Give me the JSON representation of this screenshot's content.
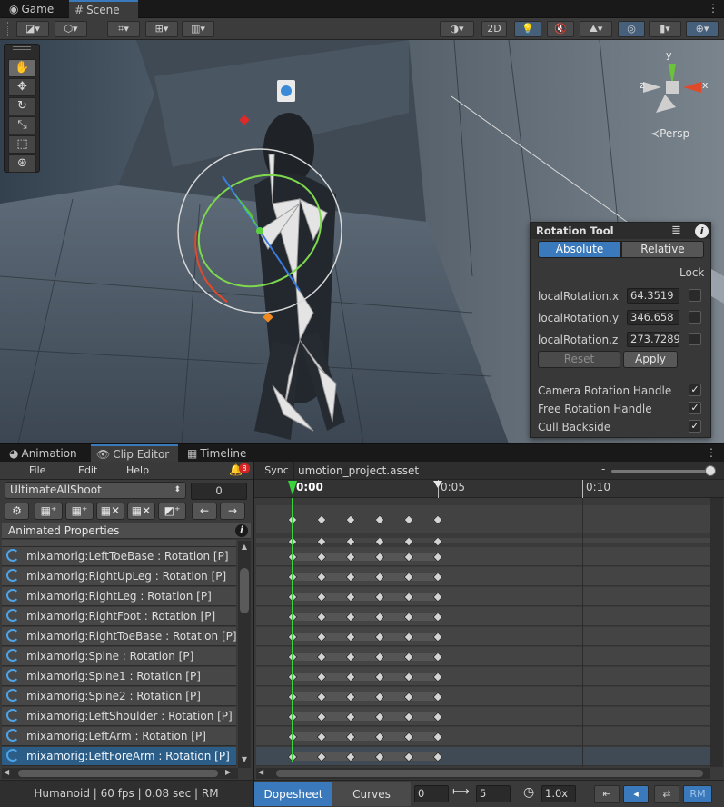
{
  "tabs_top": [
    {
      "label": "Game",
      "icon": "gamepad-icon"
    },
    {
      "label": "Scene",
      "icon": "grid-icon"
    }
  ],
  "toolbar": {
    "two_d_label": "2D"
  },
  "scene": {
    "persp_label": "Persp",
    "gizmo_axes": {
      "x": "x",
      "y": "y",
      "z": "z"
    }
  },
  "tools": [
    "hand-tool",
    "move-tool",
    "rotate-tool",
    "scale-tool",
    "rect-tool",
    "transform-tool"
  ],
  "rotation_tool": {
    "title": "Rotation Tool",
    "modes": [
      "Absolute",
      "Relative"
    ],
    "active_mode": "Absolute",
    "lock_label": "Lock",
    "fields": [
      {
        "label": "localRotation.x",
        "value": "64.3519"
      },
      {
        "label": "localRotation.y",
        "value": "346.658"
      },
      {
        "label": "localRotation.z",
        "value": "273.7289"
      }
    ],
    "reset_label": "Reset",
    "apply_label": "Apply",
    "options": [
      {
        "label": "Camera Rotation Handle",
        "checked": true
      },
      {
        "label": "Free Rotation Handle",
        "checked": true
      },
      {
        "label": "Cull Backside",
        "checked": true
      }
    ]
  },
  "tabs_bottom": [
    {
      "label": "Animation",
      "icon": "animation-icon"
    },
    {
      "label": "Clip Editor",
      "icon": "eye-icon"
    },
    {
      "label": "Timeline",
      "icon": "timeline-icon"
    }
  ],
  "menu": {
    "file": "File",
    "edit": "Edit",
    "help": "Help",
    "notification_count": "8"
  },
  "clip": {
    "name": "UltimateAllShoot",
    "frame": "0"
  },
  "animated_properties_label": "Animated Properties",
  "properties": [
    "mixamorig:LeftToeBase : Rotation [P]",
    "mixamorig:RightUpLeg : Rotation [P]",
    "mixamorig:RightLeg : Rotation [P]",
    "mixamorig:RightFoot : Rotation [P]",
    "mixamorig:RightToeBase : Rotation [P]",
    "mixamorig:Spine : Rotation [P]",
    "mixamorig:Spine1 : Rotation [P]",
    "mixamorig:Spine2 : Rotation [P]",
    "mixamorig:LeftShoulder : Rotation [P]",
    "mixamorig:LeftArm : Rotation [P]",
    "mixamorig:LeftForeArm : Rotation [P]"
  ],
  "selected_property_index": 10,
  "status": "Humanoid | 60 fps | 0.08 sec | RM",
  "timeline": {
    "sync_label": "Sync",
    "asset": "umotion_project.asset",
    "ruler": [
      "0:00",
      "0:05",
      "0:10"
    ],
    "key_frames": [
      0,
      1,
      2,
      3,
      4,
      5
    ]
  },
  "bottom_bar": {
    "dopesheet_label": "Dopesheet",
    "curves_label": "Curves",
    "frame_value": "0",
    "range_value": "5",
    "speed_value": "1.0x",
    "rm_label": "RM"
  },
  "colors": {
    "accent": "#3a79bb",
    "selected_row": "#2c5d87",
    "playhead": "#3ad43a"
  }
}
